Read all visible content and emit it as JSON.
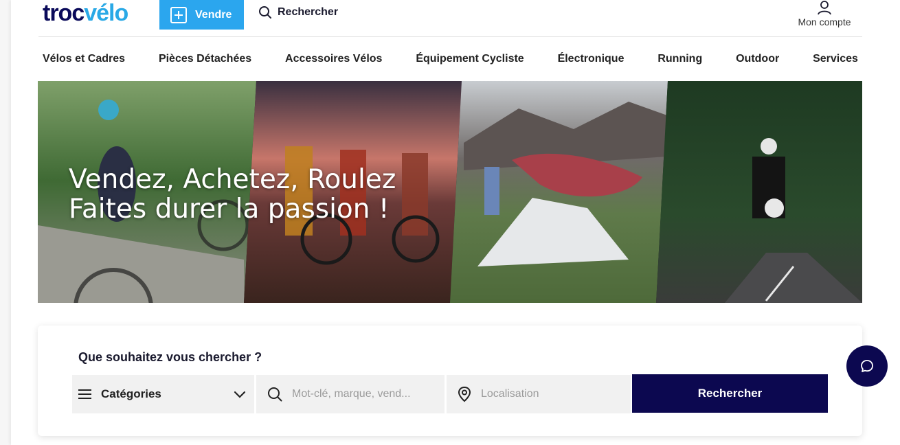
{
  "header": {
    "logo_part1": "troc",
    "logo_part2": "vélo",
    "sell_label": "Vendre",
    "search_label": "Rechercher",
    "account_label": "Mon compte"
  },
  "nav": {
    "items": [
      "Vélos et Cadres",
      "Pièces Détachées",
      "Accessoires Vélos",
      "Équipement Cycliste",
      "Électronique",
      "Running",
      "Outdoor",
      "Services"
    ]
  },
  "hero": {
    "line1": "Vendez, Achetez, Roulez",
    "line2": "Faites durer la passion !"
  },
  "search": {
    "title": "Que souhaitez vous chercher ?",
    "category_label": "Catégories",
    "keyword_placeholder": "Mot-clé, marque, vend...",
    "location_placeholder": "Localisation",
    "submit_label": "Rechercher"
  },
  "colors": {
    "brand_navy": "#0c0850",
    "brand_blue": "#2ba6ee",
    "logo_dark": "#0a0a5a"
  },
  "icons": [
    "plus-square-icon",
    "search-icon",
    "user-icon",
    "menu-icon",
    "chevron-down-icon",
    "location-pin-icon",
    "chat-icon"
  ]
}
